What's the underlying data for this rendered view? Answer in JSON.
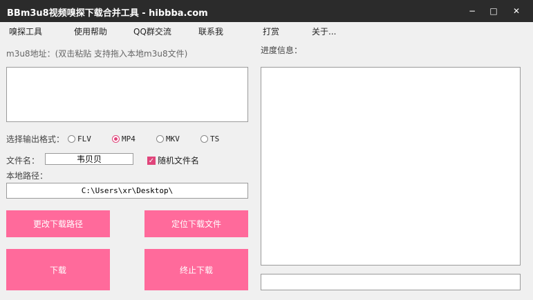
{
  "window": {
    "title": "BBm3u8视频嗅探下载合并工具 - hibbba.com",
    "controls": {
      "minimize": "−",
      "maximize": "□",
      "close": "✕"
    }
  },
  "menu": [
    "嗅探工具",
    "使用帮助",
    "QQ群交流",
    "联系我",
    "打赏",
    "关于..."
  ],
  "left": {
    "m3u8_label": "m3u8地址：(双击粘贴 支持拖入本地m3u8文件)",
    "m3u8_value": "",
    "format_label": "选择输出格式：",
    "formats": [
      {
        "label": "FLV",
        "selected": false
      },
      {
        "label": "MP4",
        "selected": true
      },
      {
        "label": "MKV",
        "selected": false
      },
      {
        "label": "TS",
        "selected": false
      }
    ],
    "filename_label": "文件名：",
    "filename_value": "韦贝贝",
    "random_name_label": "随机文件名",
    "random_name_checked": true,
    "path_label": "本地路径：",
    "path_value": "C:\\Users\\xr\\Desktop\\",
    "buttons": {
      "change_path": "更改下载路径",
      "locate_file": "定位下载文件",
      "download": "下载",
      "stop": "终止下载"
    }
  },
  "right": {
    "progress_label": "进度信息：",
    "progress_text": "",
    "status_text": ""
  },
  "colors": {
    "accent": "#ff6a9b",
    "titlebar": "#2b2b2b"
  }
}
